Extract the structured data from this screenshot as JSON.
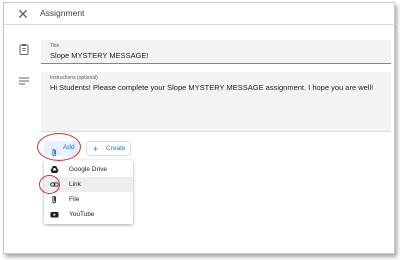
{
  "header": {
    "close_glyph": "✕",
    "title": "Assignment"
  },
  "form": {
    "title": {
      "label": "Title",
      "value": "Slope MYSTERY MESSAGE!"
    },
    "instructions": {
      "label": "Instructions (optional)",
      "value": "Hi Students! Please complete your Slope MYSTERY MESSAGE assignment. I hope you are well!"
    }
  },
  "actions": {
    "add_label": "Add",
    "create_label": "Create",
    "create_glyph": "+"
  },
  "menu": {
    "items": [
      {
        "label": "Google Drive",
        "icon": "google-drive-icon"
      },
      {
        "label": "Link",
        "icon": "link-icon",
        "highlighted": true
      },
      {
        "label": "File",
        "icon": "paperclip-icon"
      },
      {
        "label": "YouTube",
        "icon": "youtube-icon"
      }
    ]
  },
  "colors": {
    "accent": "#1a73e8",
    "annotation": "#d32f2f",
    "field_bg": "#f1f3f4"
  }
}
